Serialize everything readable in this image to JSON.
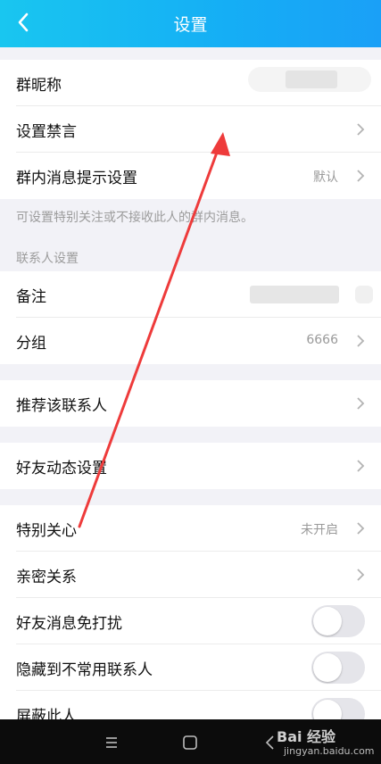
{
  "header": {
    "title": "设置"
  },
  "group_nickname": {
    "label": "群昵称"
  },
  "mute_settings": {
    "label": "设置禁言"
  },
  "group_msg_notify": {
    "label": "群内消息提示设置",
    "value": "默认"
  },
  "notes": {
    "group_msg_hint": "可设置特别关注或不接收此人的群内消息。"
  },
  "contact_settings": {
    "section_label": "联系人设置"
  },
  "remark": {
    "label": "备注"
  },
  "grouping": {
    "label": "分组",
    "value": "6666"
  },
  "recommend": {
    "label": "推荐该联系人"
  },
  "friend_feed": {
    "label": "好友动态设置"
  },
  "special_care": {
    "label": "特别关心",
    "value": "未开启"
  },
  "intimacy": {
    "label": "亲密关系"
  },
  "dnd": {
    "label": "好友消息免打扰",
    "on": false
  },
  "hide_contact": {
    "label": "隐藏到不常用联系人",
    "on": false
  },
  "block": {
    "label": "屏蔽此人",
    "on": false
  },
  "watermark": {
    "text": "Bai 经验",
    "sub": "jingyan.baidu.com"
  },
  "colors": {
    "header": "#16b4f3",
    "background": "#f2f2f7",
    "arrow": "#ee3b3b"
  }
}
